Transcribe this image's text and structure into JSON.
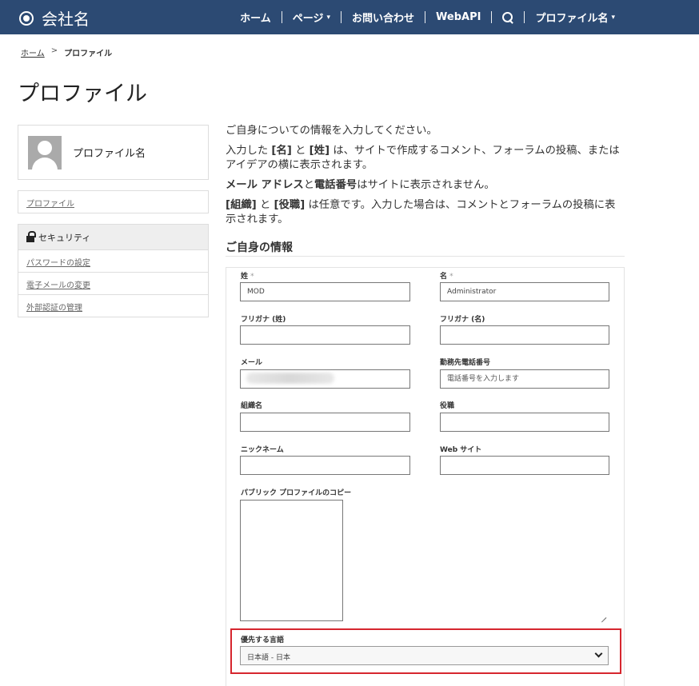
{
  "header": {
    "brand": "会社名",
    "nav": [
      {
        "label": "ホーム"
      },
      {
        "label": "ページ",
        "caret": "▾"
      },
      {
        "label": "お問い合わせ"
      },
      {
        "label": "WebAPI"
      },
      {
        "label": "",
        "icon": "search-icon"
      },
      {
        "label": "プロファイル名",
        "caret": "▾"
      }
    ],
    "colors": {
      "bar": "#2c4a73",
      "text": "#ffffff"
    }
  },
  "breadcrumb": {
    "home": "ホーム",
    "separator": ">",
    "current": "プロファイル"
  },
  "page_title": "プロファイル",
  "sidebar": {
    "profile_name": "プロファイル名",
    "profile_link": "プロファイル",
    "security_title": "セキュリティ",
    "security_items": [
      "パスワードの設定",
      "電子メールの変更",
      "外部認証の管理"
    ]
  },
  "intro": {
    "line1": "ご自身についての情報を入力してください。",
    "line2_a": "入力した ",
    "line2_b": "[名]",
    "line2_c": " と ",
    "line2_d": "[姓]",
    "line2_e": " は、サイトで作成するコメント、フォーラムの投稿、またはアイデアの横に表示されます。",
    "line3_a": "メール アドレス",
    "line3_b": "と",
    "line3_c": "電話番号",
    "line3_d": "はサイトに表示されません。",
    "line4_a": "[組織]",
    "line4_b": " と ",
    "line4_c": "[役職]",
    "line4_d": " は任意です。入力した場合は、コメントとフォーラムの投稿に表示されます。"
  },
  "form": {
    "section_title": "ご自身の情報",
    "required_mark": "*",
    "last_name": {
      "label": "姓",
      "value": "MOD"
    },
    "first_name": {
      "label": "名",
      "value": "Administrator"
    },
    "furigana_last": {
      "label": "フリガナ (姓)",
      "value": ""
    },
    "furigana_first": {
      "label": "フリガナ (名)",
      "value": ""
    },
    "email": {
      "label": "メール"
    },
    "work_phone": {
      "label": "勤務先電話番号",
      "placeholder": "電話番号を入力します"
    },
    "organization": {
      "label": "組織名",
      "value": ""
    },
    "job_title": {
      "label": "役職",
      "value": ""
    },
    "nickname": {
      "label": "ニックネーム",
      "value": ""
    },
    "website": {
      "label": "Web サイト",
      "value": ""
    },
    "public_profile": {
      "label": "パブリック プロファイルのコピー",
      "value": ""
    },
    "language": {
      "label": "優先する言語",
      "selected": "日本語 - 日本"
    },
    "highlight_color": "#d6262e"
  }
}
